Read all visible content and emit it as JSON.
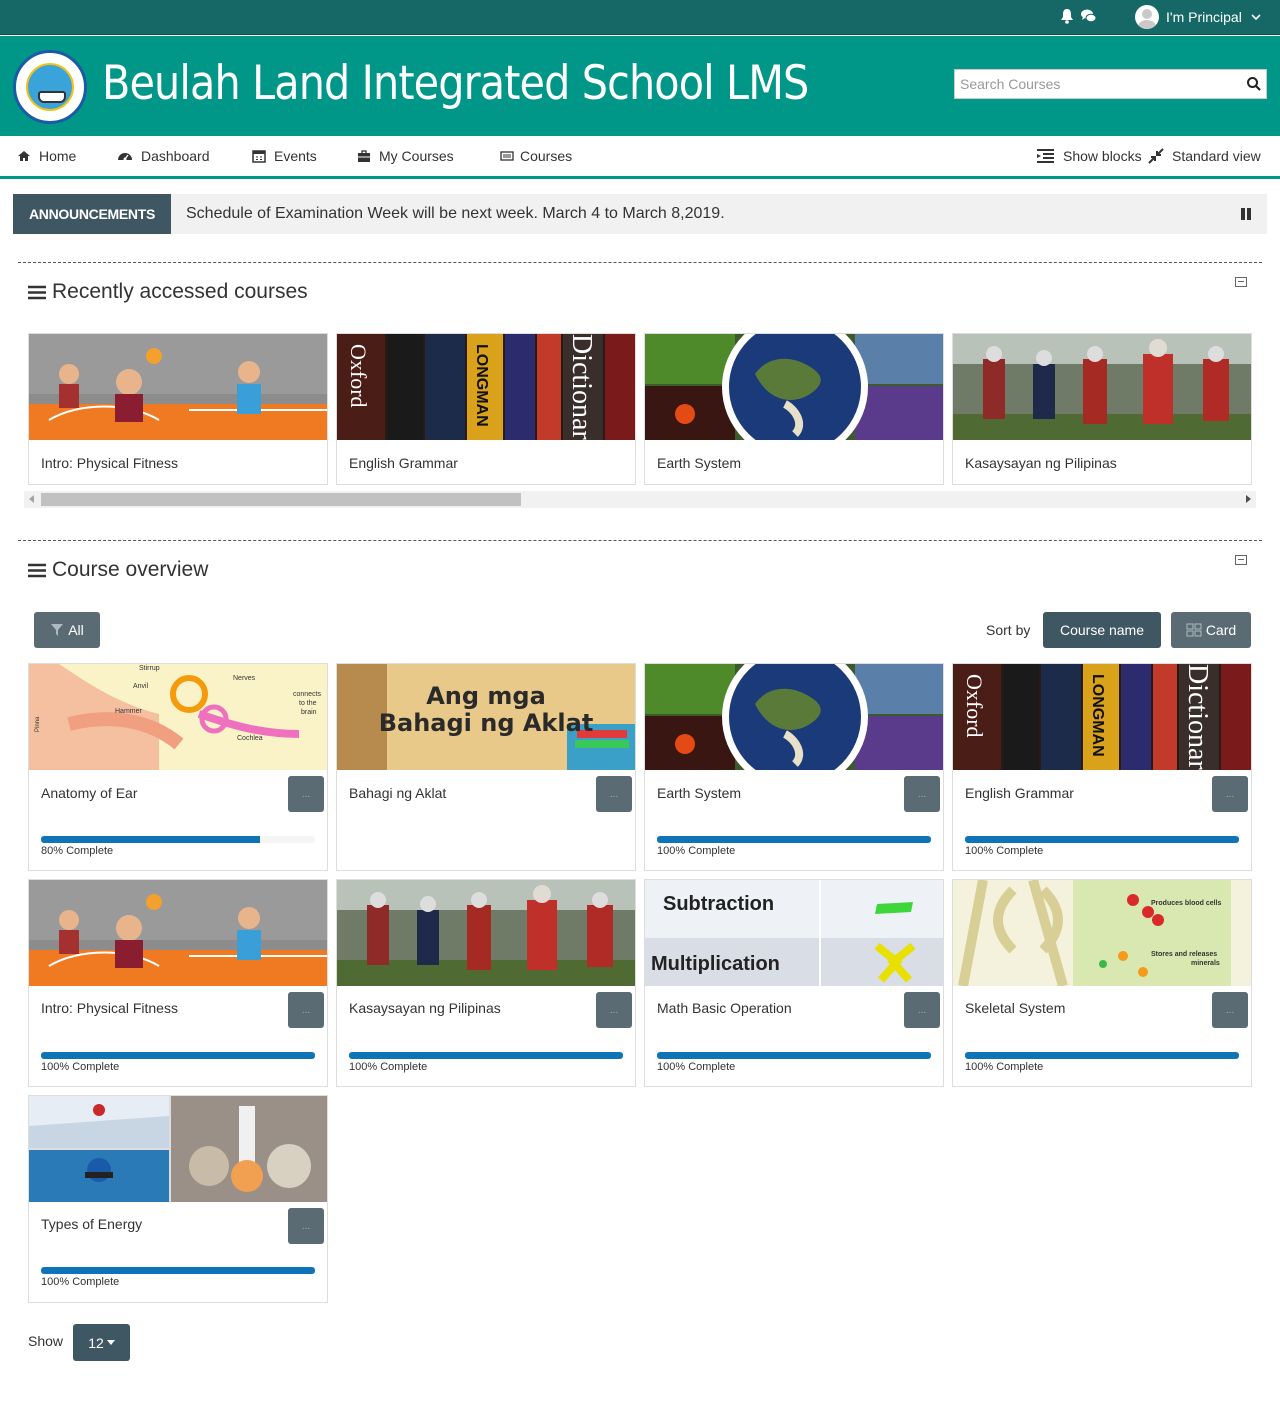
{
  "topbar": {
    "user_name": "I'm Principal",
    "icons": [
      "bell-icon",
      "chat-icon",
      "chevron-down-icon"
    ]
  },
  "header": {
    "site_title": "Beulah Land Integrated School LMS",
    "search_placeholder": "Search Courses"
  },
  "nav": {
    "items": [
      {
        "label": "Home",
        "icon": "home-icon"
      },
      {
        "label": "Dashboard",
        "icon": "dashboard-icon"
      },
      {
        "label": "Events",
        "icon": "calendar-icon"
      },
      {
        "label": "My Courses",
        "icon": "briefcase-icon"
      },
      {
        "label": "Courses",
        "icon": "courses-icon"
      }
    ],
    "show_blocks": "Show blocks",
    "standard_view": "Standard view"
  },
  "announcement": {
    "label": "ANNOUNCEMENTS",
    "text": "Schedule of Examination Week will be next week. March 4 to March 8,2019."
  },
  "recent": {
    "title": "Recently accessed courses",
    "courses": [
      {
        "name": "Intro: Physical Fitness"
      },
      {
        "name": "English Grammar"
      },
      {
        "name": "Earth System"
      },
      {
        "name": "Kasaysayan ng Pilipinas"
      }
    ]
  },
  "overview": {
    "title": "Course overview",
    "filter_label": "All",
    "sort_by_label": "Sort by",
    "sort_value": "Course name",
    "view_value": "Card",
    "menu_dots": "...",
    "courses": [
      {
        "name": "Anatomy of Ear",
        "progress": 80,
        "progress_text": "80% Complete"
      },
      {
        "name": "Bahagi ng Aklat",
        "progress": null,
        "progress_text": ""
      },
      {
        "name": "Earth System",
        "progress": 100,
        "progress_text": "100% Complete"
      },
      {
        "name": "English Grammar",
        "progress": 100,
        "progress_text": "100% Complete"
      },
      {
        "name": "Intro: Physical Fitness",
        "progress": 100,
        "progress_text": "100% Complete"
      },
      {
        "name": "Kasaysayan ng Pilipinas",
        "progress": 100,
        "progress_text": "100% Complete"
      },
      {
        "name": "Math Basic Operation",
        "progress": 100,
        "progress_text": "100% Complete"
      },
      {
        "name": "Skeletal System",
        "progress": 100,
        "progress_text": "100% Complete"
      },
      {
        "name": "Types of Energy",
        "progress": 100,
        "progress_text": "100% Complete"
      }
    ],
    "show_label": "Show",
    "show_value": "12"
  },
  "thumb_text": {
    "ear": {
      "stirrup": "Stirrup",
      "anvil": "Anvil",
      "hammer": "Hammer",
      "nerves": "Nerves",
      "connects": "connects",
      "to_the": "to the",
      "brain": "brain",
      "cochlea": "Cochlea",
      "pinna": "Pinna"
    },
    "aklat": {
      "line1": "Ang mga",
      "line2": "Bahagi ng Aklat"
    },
    "math": {
      "subtraction": "Subtraction",
      "multiplication": "Multiplication"
    },
    "skeletal": {
      "produces": "Produces blood cells",
      "stores1": "Stores and releases",
      "stores2": "minerals"
    },
    "dictionary": {
      "oxford": "Oxford",
      "longman": "LONGMAN",
      "dictionary": "Dictionar"
    }
  },
  "colors": {
    "topbar": "#156866",
    "header": "#009688",
    "dark_button": "#3f5663",
    "progress": "#0f73b8"
  }
}
